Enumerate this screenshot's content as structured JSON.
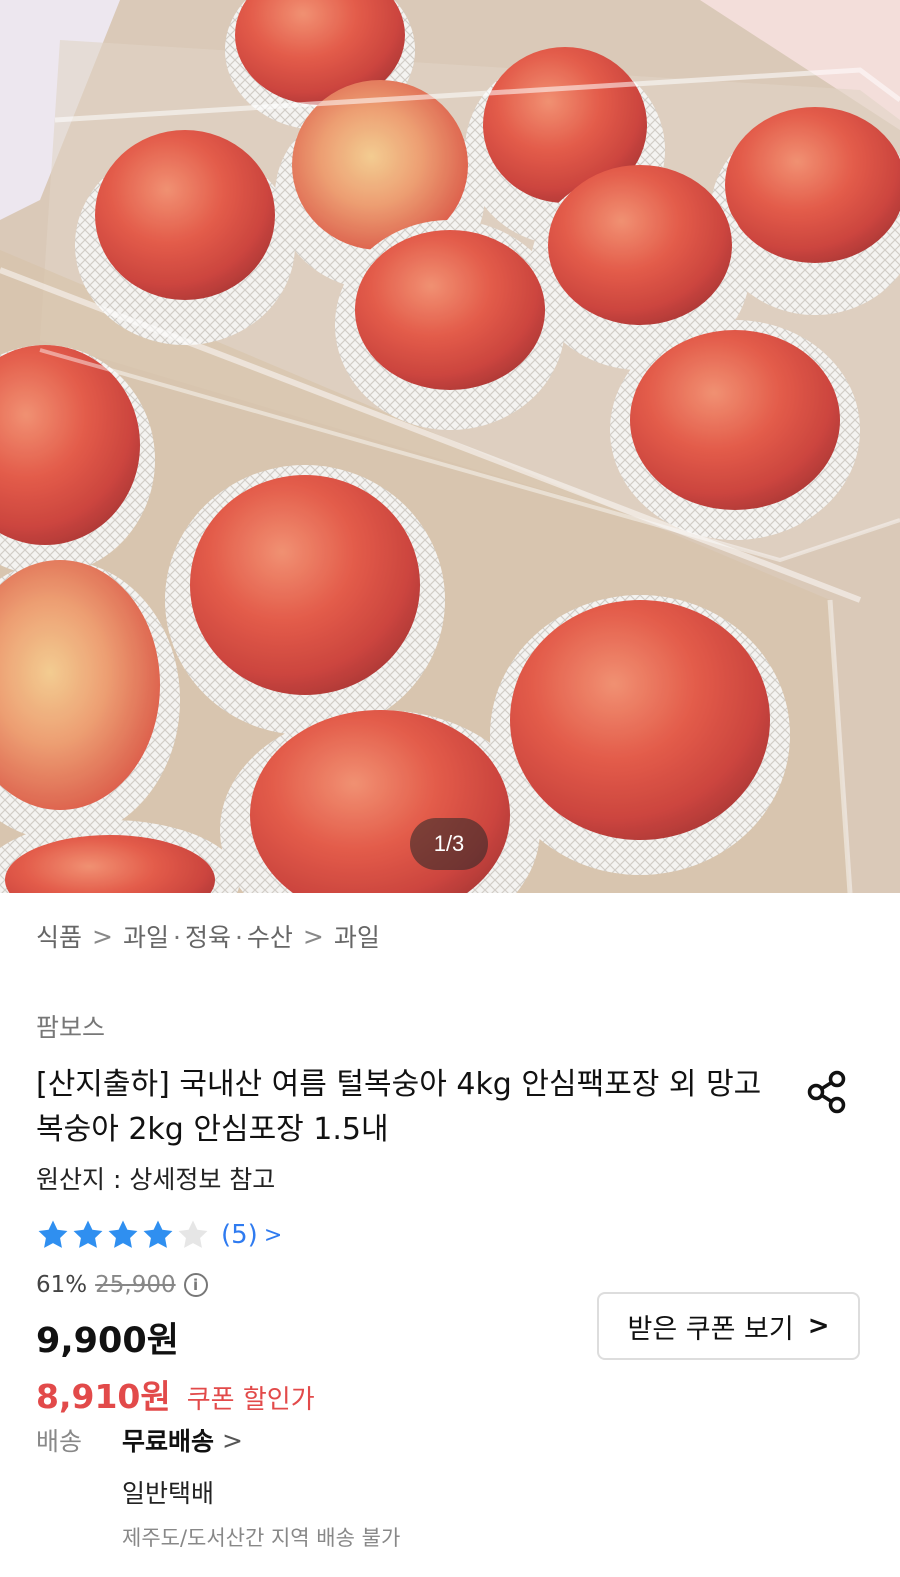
{
  "image": {
    "counter": "1/3",
    "description_icon": "peach-product-photo"
  },
  "breadcrumb": {
    "level1": "식품",
    "level2a": "과일",
    "level2b": "정육",
    "level2c": "수산",
    "level3": "과일",
    "separator": ">",
    "dot": "·"
  },
  "product": {
    "seller": "팜보스",
    "title": "[산지출하] 국내산 여름 털복숭아 4kg 안심팩포장 외 망고복숭아 2kg 안심포장 1.5내",
    "origin": "원산지 : 상세정보 참고",
    "rating_stars": 4,
    "rating_max": 5,
    "review_count": "(5)",
    "review_chevron": ">"
  },
  "price": {
    "discount_rate": "61%",
    "original_price": "25,900",
    "info_icon": "i",
    "sale_price": "9,900원",
    "coupon_price": "8,910원",
    "coupon_label": "쿠폰 할인가"
  },
  "coupon_button": {
    "label": "받은 쿠폰 보기",
    "chevron": ">"
  },
  "shipping": {
    "label": "배송",
    "type": "무료배송",
    "chevron": ">",
    "method": "일반택배",
    "note": "제주도/도서산간 지역 배송 불가"
  },
  "colors": {
    "star_filled": "#2f8ff0",
    "star_empty": "#e6e6e6",
    "coupon_red": "#e24a4a",
    "link_blue": "#2f7bf0"
  }
}
